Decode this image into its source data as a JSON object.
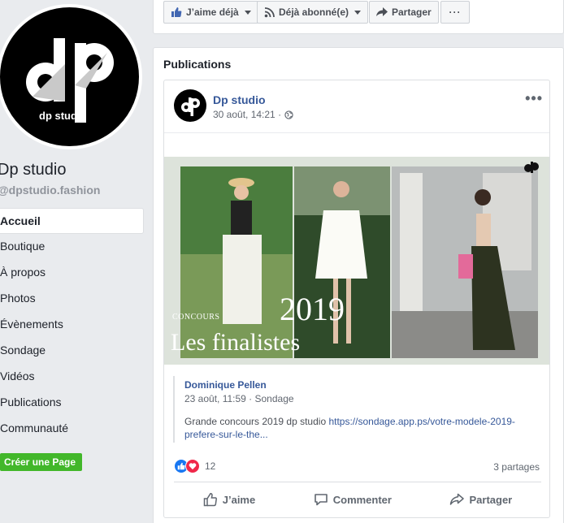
{
  "page": {
    "name": "Dp studio",
    "handle": "@dpstudio.fashion",
    "avatar_text": "dp studio"
  },
  "nav": {
    "items": [
      {
        "label": "Accueil",
        "active": true
      },
      {
        "label": "Boutique"
      },
      {
        "label": "À propos"
      },
      {
        "label": "Photos"
      },
      {
        "label": "Évènements"
      },
      {
        "label": "Sondage"
      },
      {
        "label": "Vidéos"
      },
      {
        "label": "Publications"
      },
      {
        "label": "Communauté"
      }
    ],
    "create_page_label": "Créer une Page"
  },
  "toolbar": {
    "like_label": "J’aime déjà",
    "follow_label": "Déjà abonné(e)",
    "share_label": "Partager",
    "more_label": "···"
  },
  "publications": {
    "title": "Publications",
    "post": {
      "author": "Dp studio",
      "time": "30 août, 14:21 ·",
      "more_label": "•••",
      "image": {
        "concours_text": "CONCOURS",
        "year_text": "2019",
        "finalistes_text": "Les finalistes"
      },
      "shared": {
        "author": "Dominique Pellen",
        "time": "23 août, 11:59 · Sondage",
        "text_before": "Grande concours 2019 dp studio ",
        "link_text": "https://sondage.app.ps/votre-modele-2019-prefere-sur-le-the..."
      },
      "reactions_count": "12",
      "shares_text": "3 partages",
      "actions": {
        "like": "J’aime",
        "comment": "Commenter",
        "share": "Partager"
      }
    }
  },
  "colors": {
    "facebook_blue": "#365899",
    "green": "#42b72a",
    "like_blue": "#1877f2",
    "love_red": "#f0284a"
  }
}
